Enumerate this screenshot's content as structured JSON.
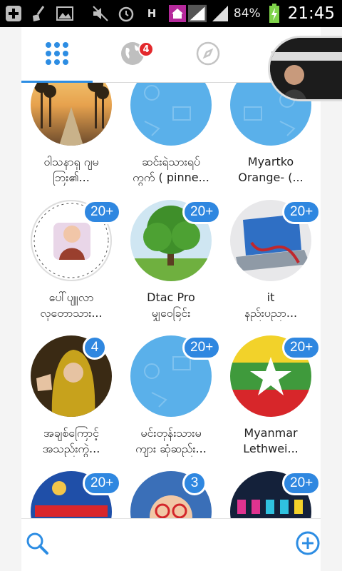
{
  "status_bar": {
    "battery_percent": "84%",
    "time": "21:45",
    "network_letter": "H",
    "icons": [
      "add-icon",
      "broom-icon",
      "image-icon",
      "mute-icon",
      "alarm-icon",
      "data-icon",
      "home-icon",
      "signal-icon",
      "signal-icon",
      "battery-icon"
    ]
  },
  "tabs": [
    {
      "name": "grid",
      "icon": "grid-icon",
      "active": true
    },
    {
      "name": "global",
      "icon": "globe-icon",
      "badge": "4"
    },
    {
      "name": "discover",
      "icon": "compass-icon"
    },
    {
      "name": "settings",
      "icon": "gear-icon"
    }
  ],
  "groups": [
    {
      "line1": "ဝါသနာရှ  ဂျမ",
      "line2": "ဘြး၏...",
      "count": "",
      "avatar": "sunset-road"
    },
    {
      "line1": "ဆင်းရဲသားရပ်",
      "line2": "ကွက် ( pinne...",
      "count": "",
      "avatar": "blue"
    },
    {
      "line1": "Myartko",
      "line2": "Orange- (...",
      "count": "",
      "avatar": "blue"
    },
    {
      "line1": "ပေါ်ပျူလာ",
      "line2": "လှတောသား...",
      "count": "20+",
      "avatar": "child-photo"
    },
    {
      "line1": "Dtac Pro",
      "line2": "မျှဝေခြင်း",
      "count": "20+",
      "avatar": "tree"
    },
    {
      "line1": "it",
      "line2": "နည်းပညာ...",
      "count": "20+",
      "avatar": "laptop"
    },
    {
      "line1": "အချစ်ကြောင့်",
      "line2": "အသည်းကွဲ...",
      "count": "4",
      "avatar": "hooded-girl"
    },
    {
      "line1": "မင်းတုန်းသားမ",
      "line2": "ကျား ဆုံဆည်း...",
      "count": "20+",
      "avatar": "blue"
    },
    {
      "line1": "Myanmar",
      "line2": "Lethwei...",
      "count": "20+",
      "avatar": "mlf-flag"
    },
    {
      "line1": "",
      "line2": "",
      "count": "20+",
      "avatar": "blue-banner"
    },
    {
      "line1": "",
      "line2": "",
      "count": "3",
      "avatar": "baby-glasses"
    },
    {
      "line1": "",
      "line2": "",
      "count": "20+",
      "avatar": "dark-art"
    }
  ],
  "bottom_bar": {
    "search_icon": "search-icon",
    "add_icon": "add-circle-icon"
  },
  "colors": {
    "accent": "#2d8de3",
    "badge_red": "#e3282c",
    "count_blue": "#2f87e0"
  }
}
